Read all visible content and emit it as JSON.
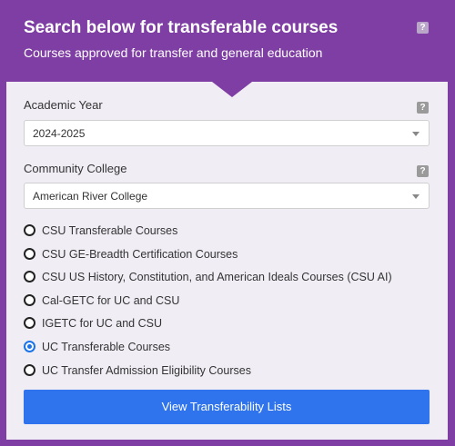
{
  "header": {
    "title": "Search below for transferable courses",
    "subtitle": "Courses approved for transfer and general education",
    "help_label": "?"
  },
  "academic_year": {
    "label": "Academic Year",
    "help_label": "?",
    "selected": "2024-2025"
  },
  "community_college": {
    "label": "Community College",
    "help_label": "?",
    "selected": "American River College"
  },
  "options": [
    {
      "label": "CSU Transferable Courses",
      "checked": false
    },
    {
      "label": "CSU GE-Breadth Certification Courses",
      "checked": false
    },
    {
      "label": "CSU US History, Constitution, and American Ideals Courses (CSU AI)",
      "checked": false
    },
    {
      "label": "Cal-GETC for UC and CSU",
      "checked": false
    },
    {
      "label": "IGETC for UC and CSU",
      "checked": false
    },
    {
      "label": "UC Transferable Courses",
      "checked": true
    },
    {
      "label": "UC Transfer Admission Eligibility Courses",
      "checked": false
    }
  ],
  "button": {
    "label": "View Transferability Lists"
  },
  "colors": {
    "header_purple": "#7f3ea3",
    "panel_bg": "#f1edf5",
    "button_blue": "#2f74ec",
    "radio_checked": "#1a73e8"
  }
}
